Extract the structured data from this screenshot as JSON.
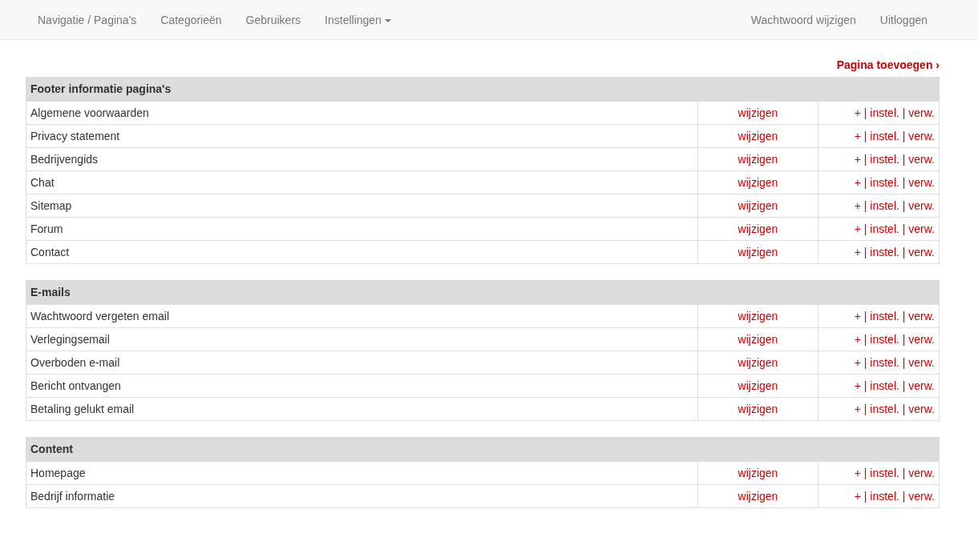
{
  "navbar": {
    "left": [
      {
        "label": "Navigatie / Pagina's",
        "dropdown": false
      },
      {
        "label": "Categorieën",
        "dropdown": false
      },
      {
        "label": "Gebruikers",
        "dropdown": false
      },
      {
        "label": "Instellingen",
        "dropdown": true
      }
    ],
    "right": [
      {
        "label": "Wachtwoord wijzigen"
      },
      {
        "label": "Uitloggen"
      }
    ]
  },
  "add_link": "Pagina toevoegen ›",
  "sections": [
    {
      "title": "Footer informatie pagina's",
      "rows": [
        {
          "name": "Algemene voorwaarden",
          "edit": "wijzigen",
          "actions": [
            "+",
            "instel.",
            "verw."
          ],
          "separator": "|"
        },
        {
          "name": "Privacy statement",
          "edit": "wijzigen",
          "actions": [
            "+",
            "instel.",
            "verw."
          ],
          "separator": "|"
        },
        {
          "name": "Bedrijvengids",
          "edit": "wijzigen",
          "actions": [
            "+",
            "instel.",
            "verw."
          ],
          "separator": "|"
        },
        {
          "name": "Chat",
          "edit": "wijzigen",
          "actions": [
            "+",
            "instel.",
            "verw."
          ],
          "separator": "|"
        },
        {
          "name": "Sitemap",
          "edit": "wijzigen",
          "actions": [
            "+",
            "instel.",
            "verw."
          ],
          "separator": "|"
        },
        {
          "name": "Forum",
          "edit": "wijzigen",
          "actions": [
            "+",
            "instel.",
            "verw."
          ],
          "separator": "|"
        },
        {
          "name": "Contact",
          "edit": "wijzigen",
          "actions": [
            "+",
            "instel.",
            "verw."
          ],
          "separator": "|"
        }
      ]
    },
    {
      "title": "E-mails",
      "rows": [
        {
          "name": "Wachtwoord vergeten email",
          "edit": "wijzigen",
          "actions": [
            "+",
            "instel.",
            "verw."
          ],
          "separator": "|"
        },
        {
          "name": "Verlegingsemail",
          "edit": "wijzigen",
          "actions": [
            "+",
            "instel.",
            "verw."
          ],
          "separator": "|"
        },
        {
          "name": "Overboden e-mail",
          "edit": "wijzigen",
          "actions": [
            "+",
            "instel.",
            "verw."
          ],
          "separator": "|"
        },
        {
          "name": "Bericht ontvangen",
          "edit": "wijzigen",
          "actions": [
            "+",
            "instel.",
            "verw."
          ],
          "separator": "|"
        },
        {
          "name": "Betaling gelukt email",
          "edit": "wijzigen",
          "actions": [
            "+",
            "instel.",
            "verw."
          ],
          "separator": "|"
        }
      ]
    },
    {
      "title": "Content",
      "rows": [
        {
          "name": "Homepage",
          "edit": "wijzigen",
          "actions": [
            "+",
            "instel.",
            "verw."
          ],
          "separator": "|"
        },
        {
          "name": "Bedrijf informatie",
          "edit": "wijzigen",
          "actions": [
            "+",
            "instel.",
            "verw."
          ],
          "separator": "|"
        }
      ]
    }
  ]
}
